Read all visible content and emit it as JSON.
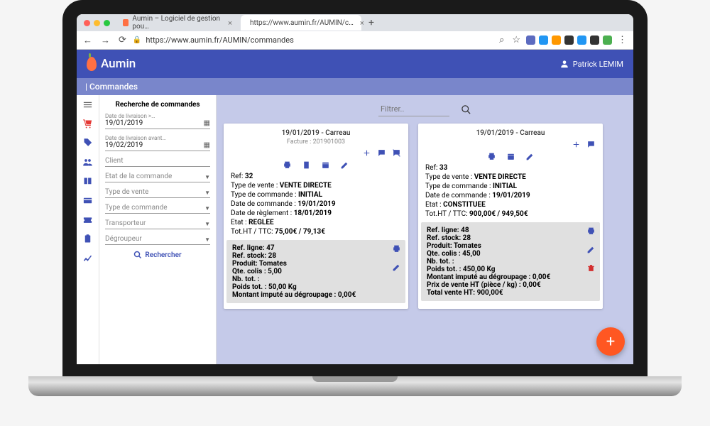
{
  "browser": {
    "tab1": "Aumin – Logiciel de gestion pou…",
    "tab2": "https://www.aumin.fr/AUMIN/c…",
    "url": "https://www.aumin.fr/AUMIN/commandes"
  },
  "app": {
    "brand": "Aumin",
    "user": "Patrick LEMIM",
    "page_title": "| Commandes"
  },
  "search": {
    "title": "Recherche de commandes",
    "date_from": {
      "label": "Date de livraison >…",
      "value": "19/01/2019"
    },
    "date_to": {
      "label": "Date de livraison avant…",
      "value": "19/02/2019"
    },
    "client": {
      "label": "Client"
    },
    "etat": {
      "label": "Etat de la commande"
    },
    "type_vente": {
      "label": "Type de vente"
    },
    "type_cmd": {
      "label": "Type de commande"
    },
    "transporteur": {
      "label": "Transporteur"
    },
    "degroupeur": {
      "label": "Dégroupeur"
    },
    "button": "Rechercher"
  },
  "filter": {
    "placeholder": "Filtrer.."
  },
  "cards": [
    {
      "header": "19/01/2019 - Carreau",
      "sub": "Facture : 201901003",
      "ref": "32",
      "type_vente": "VENTE DIRECTE",
      "type_cmd": "INITIAL",
      "date_cmd": "19/01/2019",
      "date_regl": "18/01/2019",
      "etat": "REGLEE",
      "tot": "75,00€ / 79,13€",
      "line": {
        "ref_ligne": "47",
        "ref_stock": "28",
        "produit": "Tomates",
        "qte_colis": "5,00",
        "nb_tot": "",
        "poids_tot": "50,00 Kg",
        "montant_deg": "0,00€"
      }
    },
    {
      "header": "19/01/2019 - Carreau",
      "ref": "33",
      "type_vente": "VENTE DIRECTE",
      "type_cmd": "INITIAL",
      "date_cmd": "19/01/2019",
      "etat": "CONSTITUEE",
      "tot": "900,00€ / 949,50€",
      "line": {
        "ref_ligne": "48",
        "ref_stock": "28",
        "produit": "Tomates",
        "qte_colis": "45,00",
        "nb_tot": "",
        "poids_tot": "450,00 Kg",
        "montant_deg": "0,00€",
        "prix_ht": "0,00€",
        "total_ht": "900,00€"
      }
    }
  ],
  "labels": {
    "ref": "Ref: ",
    "type_vente": "Type de vente : ",
    "type_cmd": "Type de commande : ",
    "date_cmd": "Date de commande : ",
    "date_regl": "Date de règlement : ",
    "etat": "Etat : ",
    "tot": "Tot.HT / TTC: ",
    "ref_ligne": "Ref. ligne: ",
    "ref_stock": "Ref. stock: ",
    "produit": "Produit: ",
    "qte_colis": "Qte. colis : ",
    "nb_tot": "Nb. tot. : ",
    "poids_tot": "Poids tot. : ",
    "montant_deg": "Montant imputé au dégroupage : ",
    "prix_ht": "Prix de vente HT (pièce / kg) : ",
    "total_ht": "Total vente HT: "
  }
}
